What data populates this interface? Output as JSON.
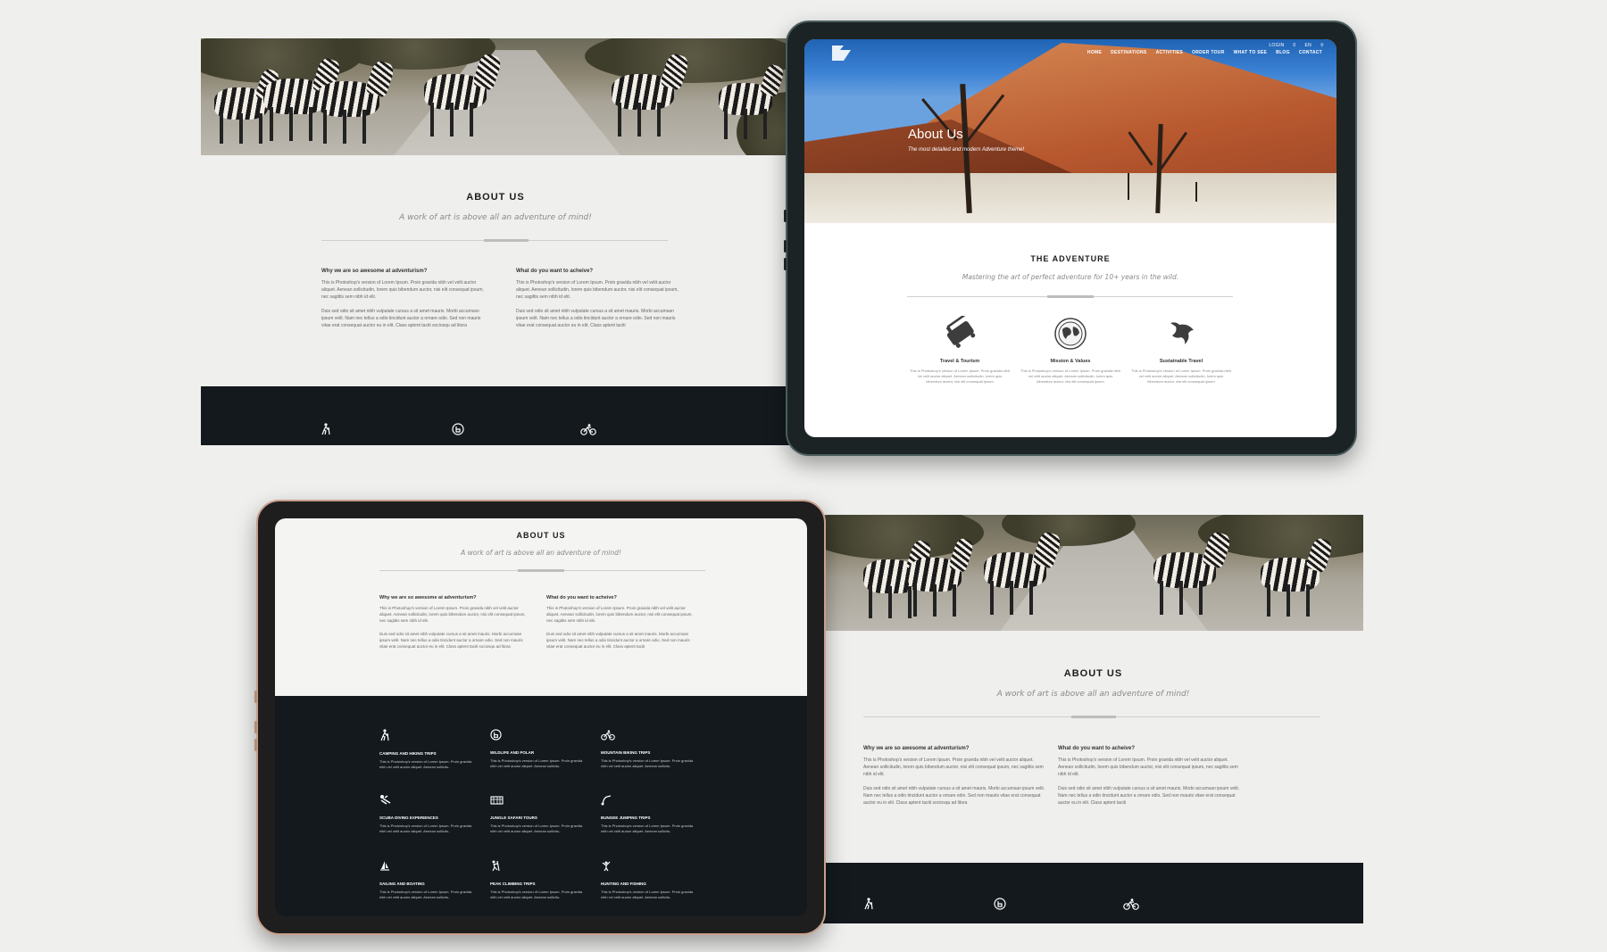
{
  "about": {
    "title": "ABOUT US",
    "subtitle": "A work of art is above all an adventure of mind!",
    "col1_heading": "Why we are so awesome at adventurism?",
    "col1_p1": "This is Photoshop's version of Lorem Ipsum. Proin gravida nibh vel velit auctor aliquet. Aenean sollicitudin, lorem quis bibendum auctor, nisi elit consequat ipsum, nec sagittis sem nibh id elit.",
    "col1_p2": "Duis sed odio sit amet nibh vulputate cursus a sit amet mauris. Morbi accumsan ipsum velit. Nam nec tellus a odio tincidunt auctor a ornare odio. Sed non mauris vitae erat consequat auctor eu in elit. Class aptent taciti sociosqu ad litora",
    "col2_heading": "What do you want to acheive?",
    "col2_p1": "This is Photoshop's version of Lorem Ipsum. Proin gravida nibh vel velit auctor aliquet. Aenean sollicitudin, lorem quis bibendum auctor, nisi elit consequat ipsum, nec sagittis sem nibh id elit.",
    "col2_p2": "Duis sed odio sit amet nibh vulputate cursus a sit amet mauris. Morbi accumsan ipsum velit. Nam nec tellus a odio tincidunt auctor a ornare odio. Sed non mauris vitae erat consequat auctor eu in elit. Class aptent taciti"
  },
  "icons": {
    "hiking": "hiking-icon",
    "wildlife": "wildlife-icon",
    "biking": "biking-icon"
  },
  "nav": {
    "items": [
      "HOME",
      "DESTINATIONS",
      "ACTIVITIES",
      "ORDER TOUR",
      "WHAT TO SEE",
      "BLOG",
      "CONTACT"
    ],
    "login": "LOGIN",
    "cart": "0",
    "lang": "EN"
  },
  "hero": {
    "title": "About Us",
    "subtitle": "The most detailed and modern Adventure theme!"
  },
  "adventure": {
    "title": "THE ADVENTURE",
    "subtitle": "Mastering the art of perfect adventure for 10+ years in the wild.",
    "features": [
      {
        "title": "Travel & Tourism",
        "text": "This is Photoshop's version of Lorem Ipsum. Proin gravida nibh vel velit auctor aliquet. Aenean sollicitudin, lorem quis bibendum auctor, nisi elit consequat ipsum"
      },
      {
        "title": "Mission & Values",
        "text": "This is Photoshop's version of Lorem Ipsum. Proin gravida nibh vel velit auctor aliquet. Aenean sollicitudin, lorem quis bibendum auctor, nisi elit consequat ipsum"
      },
      {
        "title": "Sustainable Travel",
        "text": "This is Photoshop's version of Lorem Ipsum. Proin gravida nibh vel velit auctor aliquet. Aenean sollicitudin, lorem quis bibendum auctor, nisi elit consequat ipsum"
      }
    ]
  },
  "services": [
    {
      "title": "CAMPING AND HIKING TRIPS",
      "text": "This is Photoshop's version of Lorem Ipsum. Proin gravida nibh vel velit auctor aliquet. Aenean sollicitu-",
      "icon": "hiking-icon"
    },
    {
      "title": "WILDLIFE AND POLAR",
      "text": "This is Photoshop's version of Lorem Ipsum. Proin gravida nibh vel velit auctor aliquet. Aenean sollicitu-",
      "icon": "wildlife-icon"
    },
    {
      "title": "MOUNTAIN BIKING TRIPS",
      "text": "This is Photoshop's version of Lorem Ipsum. Proin gravida nibh vel velit auctor aliquet. Aenean sollicitu-",
      "icon": "biking-icon"
    },
    {
      "title": "SCUBA DIVING EXPERIENCES",
      "text": "This is Photoshop's version of Lorem Ipsum. Proin gravida nibh vel velit auctor aliquet. Aenean sollicitu-",
      "icon": "diving-icon"
    },
    {
      "title": "JUNGLE SAFARI TOURS",
      "text": "This is Photoshop's version of Lorem Ipsum. Proin gravida nibh vel velit auctor aliquet. Aenean sollicitu-",
      "icon": "safari-icon"
    },
    {
      "title": "BUNGEE JUMPING TRIPS",
      "text": "This is Photoshop's version of Lorem Ipsum. Proin gravida nibh vel velit auctor aliquet. Aenean sollicitu-",
      "icon": "bungee-icon"
    },
    {
      "title": "SAILING AND BOATING",
      "text": "This is Photoshop's version of Lorem Ipsum. Proin gravida nibh vel velit auctor aliquet. Aenean sollicitu-",
      "icon": "sailing-icon"
    },
    {
      "title": "PEAK CLIMBING TRIPS",
      "text": "This is Photoshop's version of Lorem Ipsum. Proin gravida nibh vel velit auctor aliquet. Aenean sollicitu-",
      "icon": "climbing-icon"
    },
    {
      "title": "HUNTING AND FISHING",
      "text": "This is Photoshop's version of Lorem Ipsum. Proin gravida nibh vel velit auctor aliquet. Aenean sollicitu-",
      "icon": "fishing-icon"
    }
  ],
  "colors": {
    "background": "#efefed",
    "dark_band": "#13191d",
    "tablet_frame_top": "#2d3a3b",
    "tablet_frame_bottom": "#1e1e1e",
    "tablet_rim_bottom": "#c9a08d",
    "sky": "#2f74c8",
    "dune": "#c46a3a"
  }
}
